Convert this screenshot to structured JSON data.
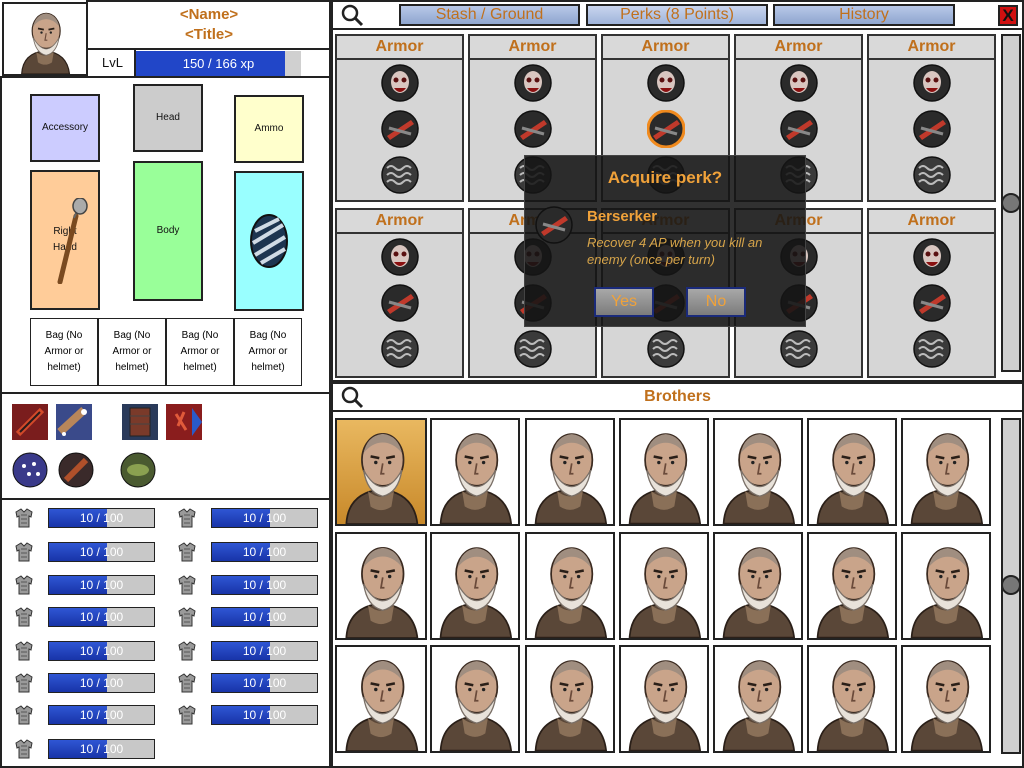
{
  "character": {
    "name": "<Name>",
    "title": "<Title>",
    "level_label": "LvL",
    "xp_text": "150 / 166 xp",
    "xp_fraction": 0.904
  },
  "equipment": {
    "accessory": "Accessory",
    "head": "Head",
    "ammo": "Ammo",
    "right_hand": "Right Hand",
    "body": "Body",
    "bags": [
      "Bag (No Armor or helmet)",
      "Bag (No Armor or helmet)",
      "Bag (No Armor or helmet)",
      "Bag (No Armor or helmet)"
    ]
  },
  "armor_bars": [
    {
      "text": "10 / 100",
      "fraction": 0.55
    },
    {
      "text": "10 / 100",
      "fraction": 0.55
    },
    {
      "text": "10 / 100",
      "fraction": 0.55
    },
    {
      "text": "10 / 100",
      "fraction": 0.55
    },
    {
      "text": "10 / 100",
      "fraction": 0.55
    },
    {
      "text": "10 / 100",
      "fraction": 0.55
    },
    {
      "text": "10 / 100",
      "fraction": 0.55
    },
    {
      "text": "10 / 100",
      "fraction": 0.55
    },
    {
      "text": "10 / 100",
      "fraction": 0.55
    },
    {
      "text": "10 / 100",
      "fraction": 0.55
    },
    {
      "text": "10 / 100",
      "fraction": 0.55
    },
    {
      "text": "10 / 100",
      "fraction": 0.55
    },
    {
      "text": "10 / 100",
      "fraction": 0.55
    },
    {
      "text": "10 / 100",
      "fraction": 0.55
    },
    {
      "text": "10 / 100",
      "fraction": 0.55
    }
  ],
  "tabs": [
    {
      "label": "Stash / Ground"
    },
    {
      "label": "Perks (8 Points)"
    },
    {
      "label": "History"
    }
  ],
  "close_label": "X",
  "perk_columns": [
    {
      "title": "Armor"
    },
    {
      "title": "Armor"
    },
    {
      "title": "Armor"
    },
    {
      "title": "Armor"
    },
    {
      "title": "Armor"
    },
    {
      "title": "Armor"
    },
    {
      "title": "Armor"
    },
    {
      "title": "Armor"
    },
    {
      "title": "Armor"
    },
    {
      "title": "Armor"
    }
  ],
  "modal": {
    "title": "Acquire perk?",
    "perk_name": "Berserker",
    "perk_description": "Recover 4 AP when you kill an enemy (once per turn)",
    "yes_label": "Yes",
    "no_label": "No"
  },
  "brothers": {
    "title": "Brothers",
    "count": 21,
    "selected_index": 0
  },
  "colors": {
    "accent_orange": "#c0701c",
    "bar_blue": "#2f56d4",
    "accessory_slot": "#ccccff",
    "head_slot": "#cccccc",
    "ammo_slot": "#ffffcc",
    "hand_slot": "#ffcc99",
    "body_slot": "#99ff99",
    "offhand_slot": "#99ffff",
    "selected_brother": "#e2a94a"
  },
  "icons": {
    "search": "magnifier-icon",
    "perk_rows": [
      "skull-perk-icon",
      "blade-perk-icon",
      "chainmail-perk-icon"
    ],
    "armor": "armor-icon"
  }
}
